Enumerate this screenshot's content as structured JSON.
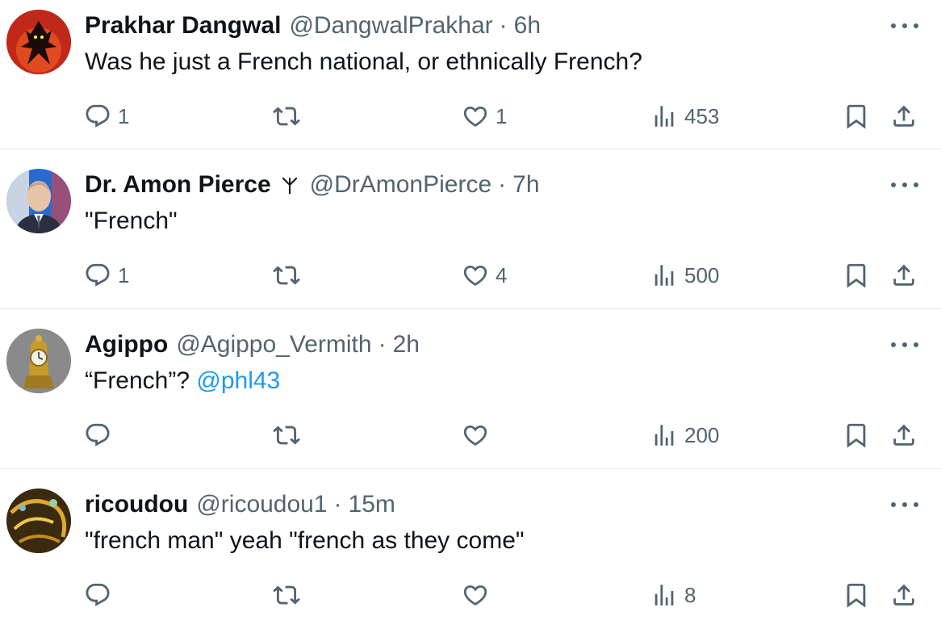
{
  "tweets": [
    {
      "name": "Prakhar Dangwal",
      "handle": "@DangwalPrakhar",
      "separator": "·",
      "time": "6h",
      "text": "Was he just a French national, or ethnically French?",
      "mention": "",
      "replies": "1",
      "retweets": "",
      "likes": "1",
      "views": "453",
      "avatar_icon": "cartoon-villain-avatar",
      "avatar_colors": [
        "#c0281a",
        "#1a0a0a"
      ]
    },
    {
      "name": "Dr. Amon Pierce",
      "badge_icon": "rune-algiz-icon",
      "handle": "@DrAmonPierce",
      "separator": "·",
      "time": "7h",
      "text": "\"French\"",
      "mention": "",
      "replies": "1",
      "retweets": "",
      "likes": "4",
      "views": "500",
      "avatar_icon": "man-in-suit-avatar",
      "avatar_colors": [
        "#2a6ad0",
        "#e7c4a8"
      ]
    },
    {
      "name": "Agippo",
      "handle": "@Agippo_Vermith",
      "separator": "·",
      "time": "2h",
      "text": "“French”? ",
      "mention": "@phl43",
      "replies": "",
      "retweets": "",
      "likes": "",
      "views": "200",
      "avatar_icon": "golden-clock-avatar",
      "avatar_colors": [
        "#7a7a7a",
        "#c79a2a"
      ]
    },
    {
      "name": "ricoudou",
      "handle": "@ricoudou1",
      "separator": "·",
      "time": "15m",
      "text": "\"french man\" yeah \"french as they come\"",
      "mention": "",
      "replies": "",
      "retweets": "",
      "likes": "",
      "views": "8",
      "avatar_icon": "golden-abstract-avatar",
      "avatar_colors": [
        "#3a2a10",
        "#e0a830"
      ]
    }
  ],
  "colors": {
    "text_primary": "#0f1419",
    "text_secondary": "#536471",
    "link": "#1d9bf0",
    "divider": "#e7e9ea"
  }
}
